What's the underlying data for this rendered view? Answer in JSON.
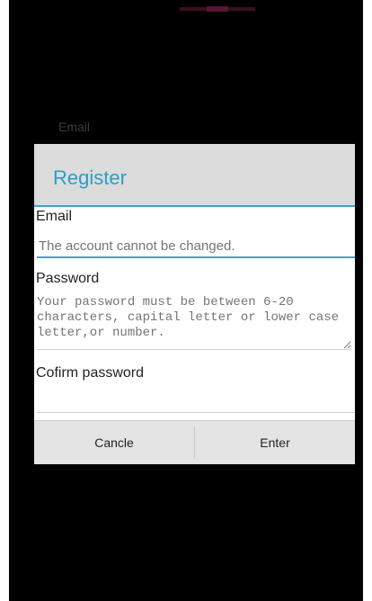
{
  "background": {
    "title": "",
    "email_label": "Email"
  },
  "dialog": {
    "title": "Register",
    "email": {
      "label": "Email",
      "placeholder": "The account cannot be changed."
    },
    "password": {
      "label": "Password",
      "placeholder": "Your password must be between 6-20 characters, capital letter or lower case letter,or number."
    },
    "confirm": {
      "label": "Cofirm password",
      "placeholder": ""
    },
    "buttons": {
      "cancel": "Cancle",
      "enter": "Enter"
    }
  },
  "colors": {
    "accent": "#2b9ec4",
    "background": "#000000",
    "dialog": "#e1e1e1"
  }
}
